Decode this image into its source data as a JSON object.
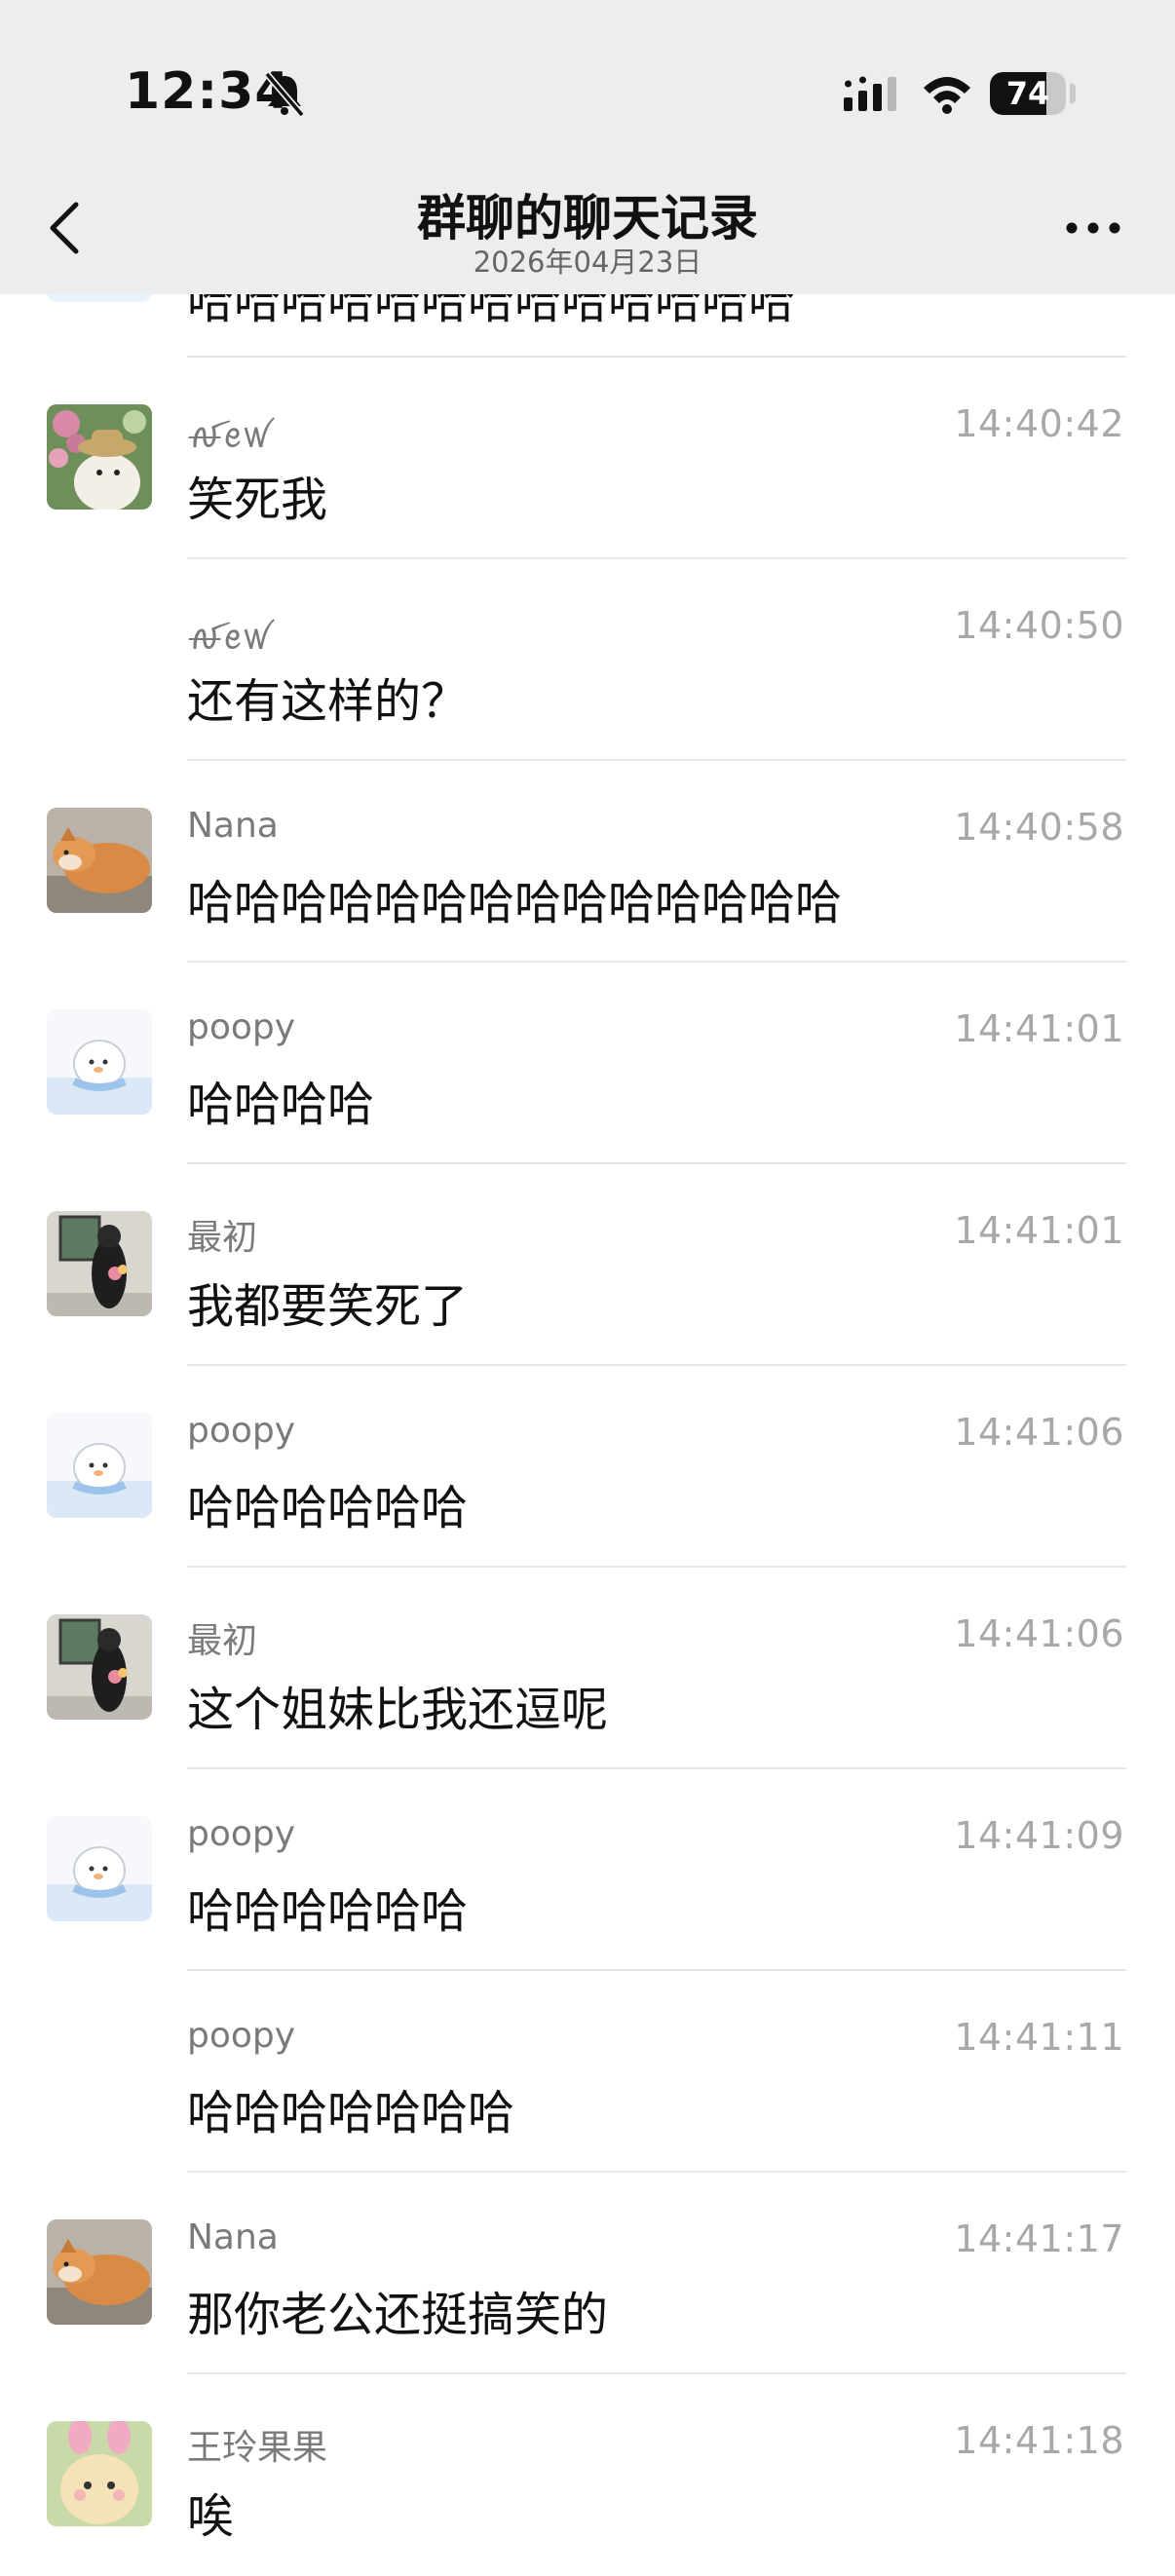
{
  "status_bar": {
    "time": "12:34",
    "battery": "74",
    "battery_level": 0.74
  },
  "nav": {
    "title": "群聊的聊天记录",
    "subtitle": "2026年04月23日"
  },
  "partial_message": {
    "text": "哈哈哈哈哈哈哈哈哈哈哈哈哈"
  },
  "messages": [
    {
      "sender": "ꫛꫀꪝ",
      "time": "14:40:42",
      "text": "笑死我",
      "avatar": "hat-cat-avatar"
    },
    {
      "sender": "ꫛꫀꪝ",
      "time": "14:40:50",
      "text": "还有这样的？",
      "avatar": ""
    },
    {
      "sender": "Nana",
      "time": "14:40:58",
      "text": "哈哈哈哈哈哈哈哈哈哈哈哈哈哈",
      "avatar": "shiba-dog-avatar"
    },
    {
      "sender": "poopy",
      "time": "14:41:01",
      "text": "哈哈哈哈",
      "avatar": "cartoon-ghost-avatar"
    },
    {
      "sender": "最初",
      "time": "14:41:01",
      "text": "我都要笑死了",
      "avatar": "person-flowers-avatar"
    },
    {
      "sender": "poopy",
      "time": "14:41:06",
      "text": "哈哈哈哈哈哈",
      "avatar": "cartoon-ghost-avatar"
    },
    {
      "sender": "最初",
      "time": "14:41:06",
      "text": "这个姐妹比我还逗呢",
      "avatar": "person-flowers-avatar"
    },
    {
      "sender": "poopy",
      "time": "14:41:09",
      "text": "哈哈哈哈哈哈",
      "avatar": "cartoon-ghost-avatar"
    },
    {
      "sender": "poopy",
      "time": "14:41:11",
      "text": "哈哈哈哈哈哈哈",
      "avatar": ""
    },
    {
      "sender": "Nana",
      "time": "14:41:17",
      "text": "那你老公还挺搞笑的",
      "avatar": "shiba-dog-avatar"
    },
    {
      "sender": "王玲果果",
      "time": "14:41:18",
      "text": "唉",
      "avatar": "plush-toy-avatar"
    }
  ]
}
